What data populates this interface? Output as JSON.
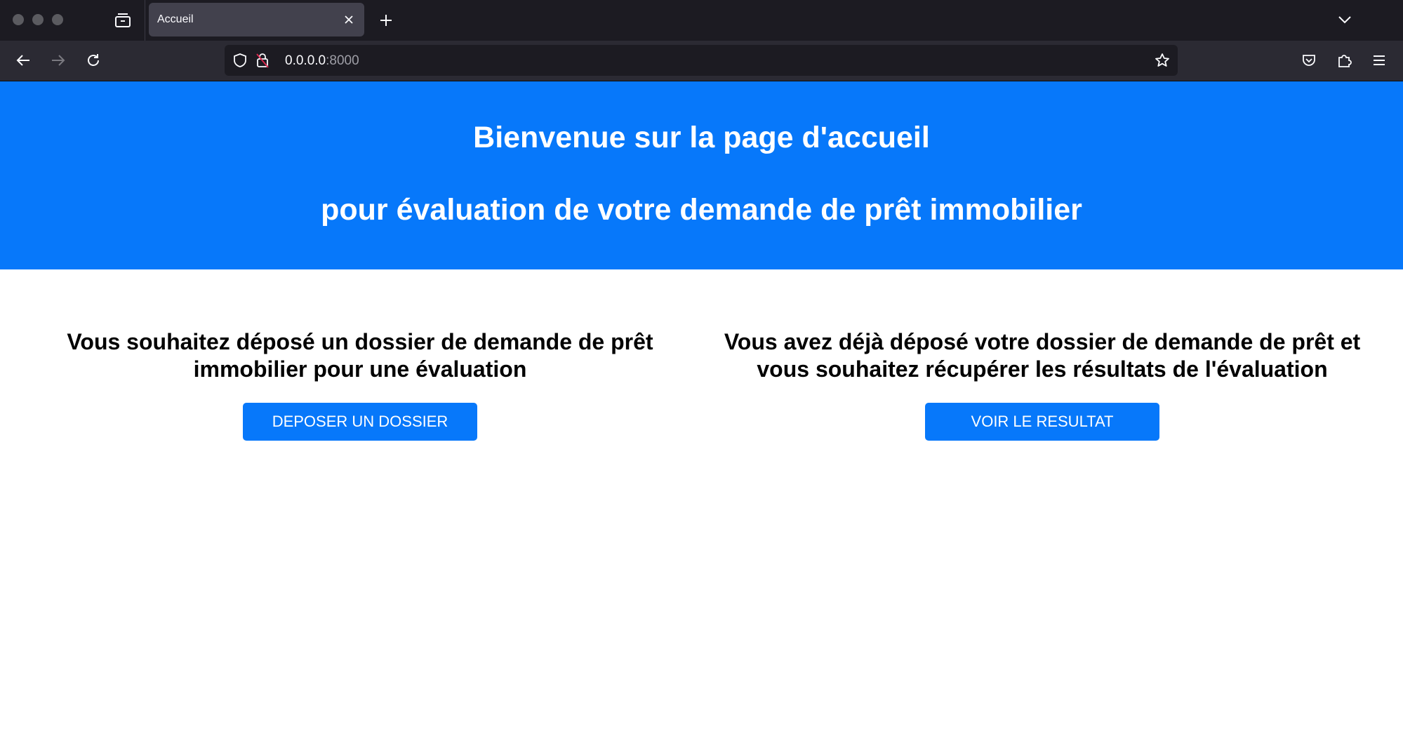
{
  "browser": {
    "tab": {
      "title": "Accueil"
    },
    "url": {
      "host": "0.0.0.0",
      "port": ":8000"
    }
  },
  "icons": {
    "tab_overview": "tab-overview-icon",
    "close": "close-icon",
    "new_tab": "plus-icon",
    "tab_list": "chevron-down-icon",
    "back": "arrow-left-icon",
    "forward": "arrow-right-icon",
    "reload": "reload-icon",
    "shield": "shield-icon",
    "lock": "insecure-lock-icon",
    "bookmark": "star-icon",
    "pocket": "pocket-icon",
    "extensions": "puzzle-icon",
    "menu": "hamburger-menu-icon"
  },
  "colors": {
    "accent": "#0778fa",
    "chrome_dark": "#1c1b22",
    "chrome_toolbar": "#2b2a33"
  },
  "hero": {
    "title_line1": "Bienvenue sur la page d'accueil",
    "title_line2": "pour évaluation de votre demande de prêt immobilier"
  },
  "sections": {
    "deposit": {
      "text": "Vous souhaitez déposé un dossier de demande de prêt immobilier pour une évaluation",
      "button": "DEPOSER UN DOSSIER"
    },
    "result": {
      "text": "Vous avez déjà déposé votre dossier de demande de prêt et vous souhaitez récupérer les résultats de l'évaluation",
      "button": "VOIR LE RESULTAT"
    }
  }
}
